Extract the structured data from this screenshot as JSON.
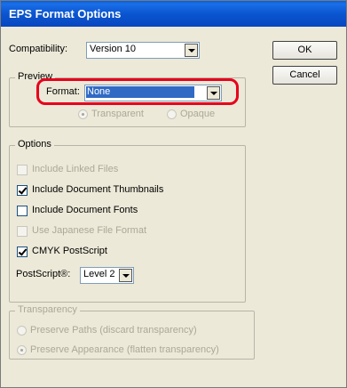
{
  "window": {
    "title": "EPS Format Options"
  },
  "compatibility": {
    "label": "Compatibility:",
    "value": "Version 10"
  },
  "buttons": {
    "ok": "OK",
    "cancel": "Cancel"
  },
  "preview": {
    "group_title": "Preview",
    "format_label": "Format:",
    "format_value": "None",
    "transparent": "Transparent",
    "opaque": "Opaque"
  },
  "options": {
    "group_title": "Options",
    "include_linked_files": "Include Linked Files",
    "include_document_thumbnails": "Include Document Thumbnails",
    "include_document_fonts": "Include Document Fonts",
    "use_japanese_file_format": "Use Japanese File Format",
    "cmyk_postscript": "CMYK PostScript",
    "postscript_label": "PostScript®:",
    "postscript_value": "Level 2"
  },
  "transparency": {
    "group_title": "Transparency",
    "preserve_paths": "Preserve Paths (discard transparency)",
    "preserve_appearance": "Preserve Appearance (flatten transparency)"
  },
  "colors": {
    "title_bar": "#0b55d0",
    "dialog_bg": "#ece9d8",
    "selection": "#316ac5",
    "highlight_ring": "#e8001c"
  }
}
